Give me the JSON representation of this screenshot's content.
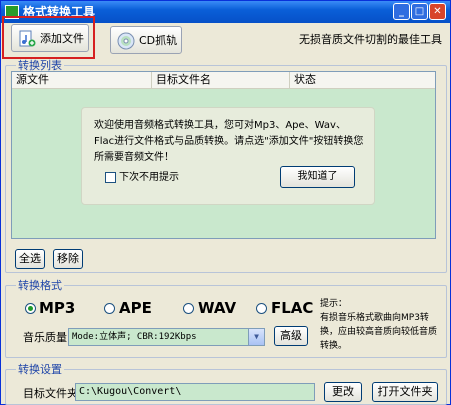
{
  "window": {
    "title": "格式转换工具",
    "minimize": "_",
    "maximize": "□",
    "close": "✕"
  },
  "toolbar": {
    "add_file": "添加文件",
    "cd_rip": "CD抓轨",
    "tagline": "无损音质文件切割的最佳工具"
  },
  "list": {
    "group_title": "转换列表",
    "columns": [
      "源文件",
      "目标文件名",
      "状态"
    ],
    "welcome_text": "欢迎使用音频格式转换工具，您可对Mp3、Ape、Wav、Flac进行文件格式与品质转换。请点选\"添加文件\"按钮转换您所需要音频文件！",
    "dont_show_label": "下次不用提示",
    "dont_show_checked": false,
    "ok_button": "我知道了",
    "select_all": "全选",
    "remove": "移除"
  },
  "format": {
    "group_title": "转换格式",
    "options": [
      "MP3",
      "APE",
      "WAV",
      "FLAC"
    ],
    "selected": "MP3",
    "hint": "提示：\n有损音乐格式歌曲向MP3转换，应由较高音质向较低音质转换。",
    "quality_label": "音乐质量",
    "quality_value": "Mode:立体声; CBR:192Kbps",
    "advanced": "高级"
  },
  "settings": {
    "group_title": "转换设置",
    "target_label": "目标文件夹",
    "target_value": "C:\\Kugou\\Convert\\",
    "change": "更改",
    "open_folder": "打开文件夹"
  },
  "colors": {
    "titlebar": "#0a5fd8",
    "list_bg": "#c9e8cd",
    "group_title": "#1f45a8",
    "highlight": "#d62020"
  }
}
